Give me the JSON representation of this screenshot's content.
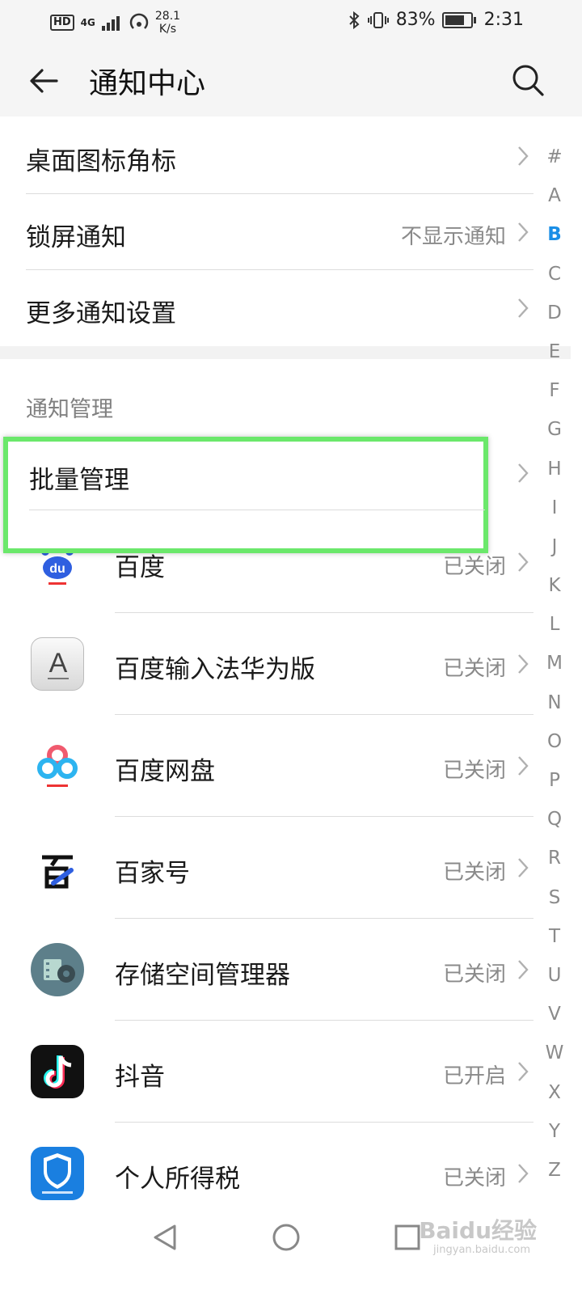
{
  "status_bar": {
    "hd": "HD",
    "network": "4G",
    "speed_value": "28.1",
    "speed_unit": "K/s",
    "battery": "83%",
    "battery_level": 0.83,
    "time": "2:31"
  },
  "header": {
    "title": "通知中心"
  },
  "settings": [
    {
      "label": "桌面图标角标",
      "value": ""
    },
    {
      "label": "锁屏通知",
      "value": "不显示通知"
    },
    {
      "label": "更多通知设置",
      "value": ""
    }
  ],
  "section_title": "通知管理",
  "batch_manage": {
    "label": "批量管理"
  },
  "apps": [
    {
      "name": "百度",
      "status": "已关闭",
      "icon": "baidu-icon"
    },
    {
      "name": "百度输入法华为版",
      "status": "已关闭",
      "icon": "baidu-input-icon"
    },
    {
      "name": "百度网盘",
      "status": "已关闭",
      "icon": "baidu-netdisk-icon"
    },
    {
      "name": "百家号",
      "status": "已关闭",
      "icon": "baijiahao-icon"
    },
    {
      "name": "存储空间管理器",
      "status": "已关闭",
      "icon": "storage-manager-icon"
    },
    {
      "name": "抖音",
      "status": "已开启",
      "icon": "douyin-icon"
    },
    {
      "name": "个人所得税",
      "status": "已关闭",
      "icon": "tax-icon"
    }
  ],
  "index_letters": [
    "#",
    "A",
    "B",
    "C",
    "D",
    "E",
    "F",
    "G",
    "H",
    "I",
    "J",
    "K",
    "L",
    "M",
    "N",
    "O",
    "P",
    "Q",
    "R",
    "S",
    "T",
    "U",
    "V",
    "W",
    "X",
    "Y",
    "Z"
  ],
  "active_index": "B",
  "watermark": {
    "text": "Baidu经验",
    "sub": "jingyan.baidu.com"
  },
  "colors": {
    "accent": "#1a8ee6",
    "highlight": "#6be86b",
    "douyin": "#111111",
    "tax": "#1a7fe0"
  }
}
